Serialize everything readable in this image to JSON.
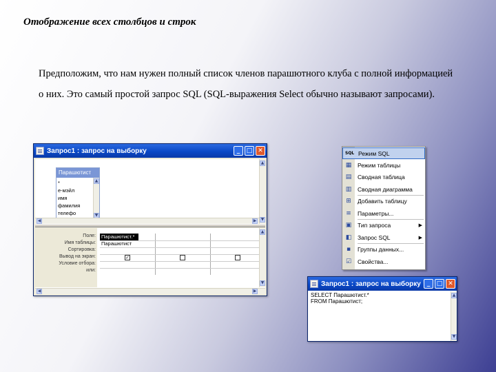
{
  "slide": {
    "title": "Отображение всех столбцов и строк",
    "paragraph": "Предположим, что нам нужен полный список членов парашютного клуба с полной информацией о них. Это самый простой запрос SQL (SQL-выражения Select обычно называют запросами)."
  },
  "query_window": {
    "title": "Запрос1 : запрос на выборку",
    "table_box": {
      "title": "Парашютист",
      "fields": [
        "*",
        "е-мэйл",
        "имя",
        "фамилия",
        "телефо"
      ]
    },
    "grid": {
      "row_labels": [
        "Поле:",
        "Имя таблицы:",
        "Сортировка:",
        "Вывод на экран:",
        "Условие отбора:",
        "или:"
      ],
      "col1": {
        "field": "Парашютист.*",
        "table": "Парашютист"
      },
      "checks": [
        "✓",
        "",
        ""
      ]
    }
  },
  "view_menu": {
    "items": [
      {
        "label": "Режим SQL",
        "icon": "sql-icon",
        "highlighted": true
      },
      {
        "label": "Режим таблицы",
        "icon": "datasheet-icon"
      },
      {
        "label": "Сводная таблица",
        "icon": "pivot-table-icon"
      },
      {
        "label": "Сводная диаграмма",
        "icon": "pivot-chart-icon"
      },
      {
        "label": "Добавить таблицу",
        "icon": "add-table-icon"
      },
      {
        "label": "Параметры...",
        "icon": "parameters-icon"
      },
      {
        "label": "Тип запроса",
        "icon": "query-type-icon",
        "submenu": true
      },
      {
        "label": "Запрос SQL",
        "icon": "sql-query-icon",
        "submenu": true
      },
      {
        "label": "Группы данных...",
        "icon": "data-groups-icon"
      },
      {
        "label": "Свойства...",
        "icon": "properties-icon"
      }
    ],
    "sql_badge": "SQL"
  },
  "sql_window": {
    "title": "Запрос1 : запрос на выборку",
    "lines": [
      "SELECT Парашютист.*",
      "FROM Парашютист;"
    ]
  },
  "colors": {
    "xp_title": "#0a48c6",
    "menu_highlight": "#c1d2ee",
    "slide_gradient_end": "#3d3f93"
  }
}
